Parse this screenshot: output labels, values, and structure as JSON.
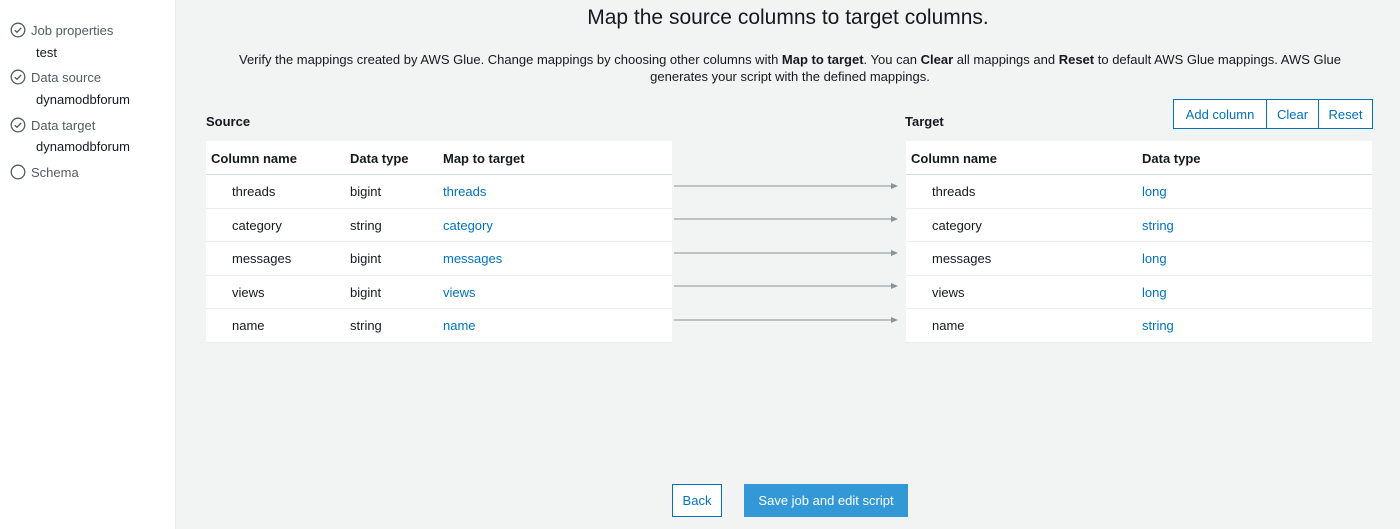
{
  "sidebar": {
    "steps": [
      {
        "title": "Job properties",
        "subtitle": "test",
        "done": true
      },
      {
        "title": "Data source",
        "subtitle": "dynamodbforum",
        "done": true
      },
      {
        "title": "Data target",
        "subtitle": "dynamodbforum",
        "done": true
      },
      {
        "title": "Schema",
        "subtitle": "",
        "done": false
      }
    ]
  },
  "main": {
    "title": "Map the source columns to target columns.",
    "description": {
      "p1": "Verify the mappings created by AWS Glue. Change mappings by choosing other columns with ",
      "b1": "Map to target",
      "p2": ". You can ",
      "b2": "Clear",
      "p3": " all mappings and ",
      "b3": "Reset",
      "p4": " to default AWS Glue mappings. AWS Glue generates your script with the defined mappings."
    },
    "source_label": "Source",
    "target_label": "Target",
    "buttons": {
      "add_column": "Add column",
      "clear": "Clear",
      "reset": "Reset"
    },
    "source_table": {
      "headers": [
        "Column name",
        "Data type",
        "Map to target"
      ],
      "rows": [
        {
          "name": "threads",
          "type": "bigint",
          "map": "threads"
        },
        {
          "name": "category",
          "type": "string",
          "map": "category"
        },
        {
          "name": "messages",
          "type": "bigint",
          "map": "messages"
        },
        {
          "name": "views",
          "type": "bigint",
          "map": "views"
        },
        {
          "name": "name",
          "type": "string",
          "map": "name"
        }
      ]
    },
    "target_table": {
      "headers": [
        "Column name",
        "Data type"
      ],
      "rows": [
        {
          "name": "threads",
          "type": "long"
        },
        {
          "name": "category",
          "type": "string"
        },
        {
          "name": "messages",
          "type": "long"
        },
        {
          "name": "views",
          "type": "long"
        },
        {
          "name": "name",
          "type": "string"
        }
      ]
    },
    "footer": {
      "back": "Back",
      "save": "Save job and edit script"
    }
  },
  "colors": {
    "accent": "#0073bb",
    "primary_button": "#3399d6",
    "step_check": "#1d8102",
    "arrow": "#879596"
  },
  "icons": {
    "step_done": "check-circle-icon",
    "step_pending": "empty-circle-icon",
    "mapping": "arrow-right-icon"
  }
}
